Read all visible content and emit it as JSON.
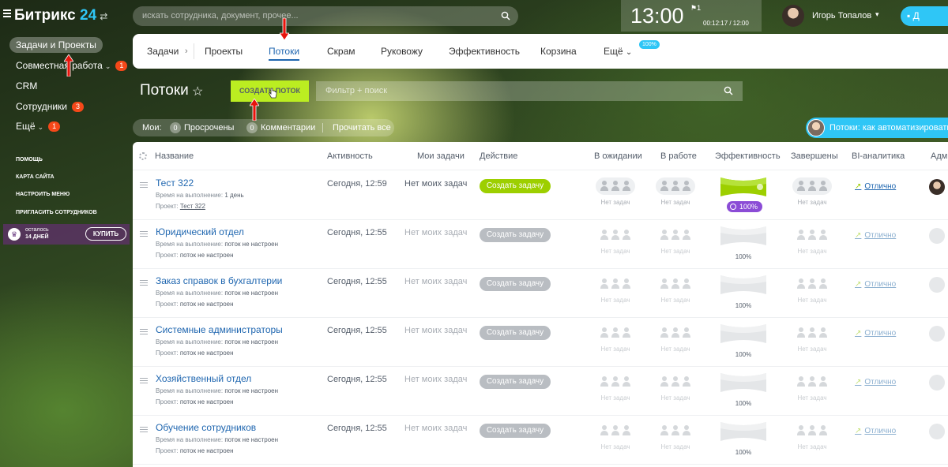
{
  "topbar": {
    "logo_main": "Битрикс",
    "logo_num": "24",
    "logo_switch": "⇄",
    "search_placeholder": "искать сотрудника, документ, прочее...",
    "clock": "13:00",
    "flag_count": "1",
    "timer": "00:12:17 / 12:00",
    "user_name": "Игорь Топалов",
    "user_caret": "▾",
    "chat_label": "Д"
  },
  "sidebar": {
    "items": [
      {
        "label": "Задачи и Проекты",
        "badge": "",
        "caret": ""
      },
      {
        "label": "Совместная работа",
        "badge": "1",
        "caret": "⌄"
      },
      {
        "label": "CRM",
        "badge": "",
        "caret": ""
      },
      {
        "label": "Сотрудники",
        "badge": "3",
        "caret": ""
      },
      {
        "label": "Ещё",
        "badge": "1",
        "caret": "⌄"
      }
    ],
    "links": [
      "Помощь",
      "Карта сайта",
      "Настроить меню",
      "Пригласить сотрудников"
    ],
    "trial_line1": "осталось",
    "trial_line2": "14 ДНЕЙ",
    "buy_label": "КУПИТЬ"
  },
  "tabs": {
    "items": [
      "Задачи",
      "Проекты",
      "Потоки",
      "Скрам",
      "Руковожу",
      "Эффективность",
      "Корзина",
      "Ещё"
    ],
    "active": "Потоки",
    "eff_badge": "100%",
    "chev": "›",
    "more_caret": "⌄"
  },
  "page": {
    "title": "Потоки",
    "create_button": "СОЗДАТЬ ПОТОК",
    "filter_placeholder": "Фильтр + поиск"
  },
  "counters": {
    "mine": "Мои:",
    "overdue_count": "0",
    "overdue_label": "Просрочены",
    "comments_count": "0",
    "comments_label": "Комментарии",
    "read_all": "Прочитать все"
  },
  "promo": "Потоки: как автоматизировать",
  "grid": {
    "columns": [
      "Название",
      "Активность",
      "Мои задачи",
      "Действие",
      "В ожидании",
      "В работе",
      "Эффективность",
      "Завершены",
      "BI-аналитика",
      "Адм"
    ],
    "rows": [
      {
        "name": "Тест 322",
        "time_label": "Время на выполнение:",
        "time_value": "1 день",
        "project_label": "Проект:",
        "project_value": "Тест 322",
        "activity": "Сегодня, 12:59",
        "my_tasks": "Нет моих задач",
        "action": "Создать задачу",
        "waiting": "Нет задач",
        "working": "Нет задач",
        "efficiency": "100%",
        "done": "Нет задач",
        "bi": "Отлично",
        "active": true
      },
      {
        "name": "Юридический отдел",
        "time_label": "Время на выполнение:",
        "time_value": "поток не настроен",
        "project_label": "Проект:",
        "project_value": "поток не настроен",
        "activity": "Сегодня, 12:55",
        "my_tasks": "Нет моих задач",
        "action": "Создать задачу",
        "waiting": "Нет задач",
        "working": "Нет задач",
        "efficiency": "100%",
        "done": "Нет задач",
        "bi": "Отлично",
        "active": false
      },
      {
        "name": "Заказ справок в бухгалтерии",
        "time_label": "Время на выполнение:",
        "time_value": "поток не настроен",
        "project_label": "Проект:",
        "project_value": "поток не настроен",
        "activity": "Сегодня, 12:55",
        "my_tasks": "Нет моих задач",
        "action": "Создать задачу",
        "waiting": "Нет задач",
        "working": "Нет задач",
        "efficiency": "100%",
        "done": "Нет задач",
        "bi": "Отлично",
        "active": false
      },
      {
        "name": "Системные администраторы",
        "time_label": "Время на выполнение:",
        "time_value": "поток не настроен",
        "project_label": "Проект:",
        "project_value": "поток не настроен",
        "activity": "Сегодня, 12:55",
        "my_tasks": "Нет моих задач",
        "action": "Создать задачу",
        "waiting": "Нет задач",
        "working": "Нет задач",
        "efficiency": "100%",
        "done": "Нет задач",
        "bi": "Отлично",
        "active": false
      },
      {
        "name": "Хозяйственный отдел",
        "time_label": "Время на выполнение:",
        "time_value": "поток не настроен",
        "project_label": "Проект:",
        "project_value": "поток не настроен",
        "activity": "Сегодня, 12:55",
        "my_tasks": "Нет моих задач",
        "action": "Создать задачу",
        "waiting": "Нет задач",
        "working": "Нет задач",
        "efficiency": "100%",
        "done": "Нет задач",
        "bi": "Отлично",
        "active": false
      },
      {
        "name": "Обучение сотрудников",
        "time_label": "Время на выполнение:",
        "time_value": "поток не настроен",
        "project_label": "Проект:",
        "project_value": "поток не настроен",
        "activity": "Сегодня, 12:55",
        "my_tasks": "Нет моих задач",
        "action": "Создать задачу",
        "waiting": "Нет задач",
        "working": "Нет задач",
        "efficiency": "100%",
        "done": "Нет задач",
        "bi": "Отлично",
        "active": false
      }
    ]
  },
  "colors": {
    "accent_blue": "#2067b0",
    "create_green": "#bbed21",
    "action_green": "#9dcf00",
    "badge_red": "#f54819",
    "efficiency_purple": "#8b4cd6",
    "arrow_red": "#e8140c"
  }
}
